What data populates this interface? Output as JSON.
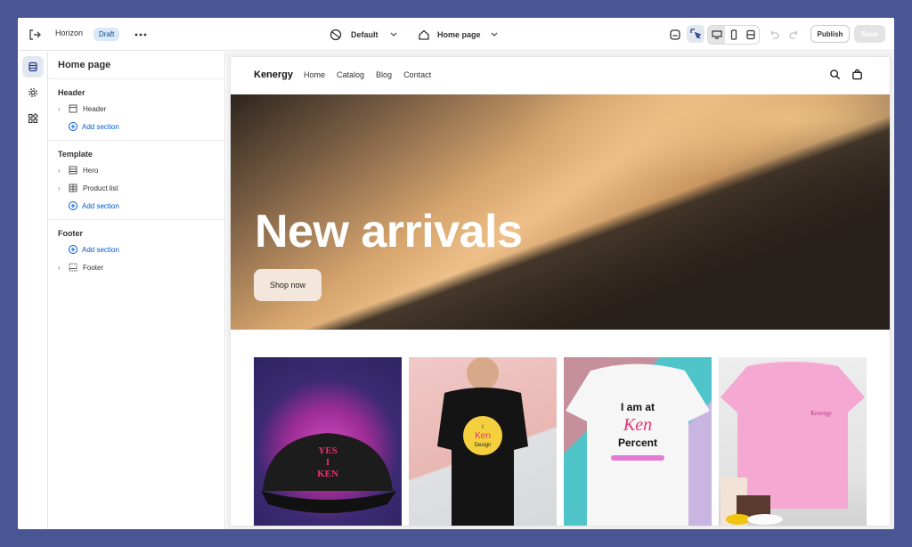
{
  "topbar": {
    "exit_icon": "exit-icon",
    "theme_name": "Horizon",
    "status_badge": "Draft",
    "template_select": "Default",
    "page_select": "Home page",
    "publish_label": "Publish",
    "save_label": "Save"
  },
  "sidebar": {
    "title": "Home page",
    "groups": [
      {
        "label": "Header",
        "items": [
          "Header"
        ],
        "add_label": "Add section"
      },
      {
        "label": "Template",
        "items": [
          "Hero",
          "Product list"
        ],
        "add_label": "Add section"
      },
      {
        "label": "Footer",
        "items": [
          "Footer"
        ],
        "add_label": "Add section"
      }
    ]
  },
  "store": {
    "brand": "Kenergy",
    "nav": [
      "Home",
      "Catalog",
      "Blog",
      "Contact"
    ],
    "hero_title": "New arrivals",
    "hero_button": "Shop now",
    "products": [
      {
        "print": [
          "YES",
          "I",
          "KEN"
        ]
      },
      {
        "print": [
          "I",
          "Ken",
          "Design"
        ]
      },
      {
        "print": [
          "I am at",
          "Ken",
          "Percent"
        ]
      },
      {
        "print": [
          "Kenergy"
        ]
      }
    ]
  },
  "colors": {
    "frame": "#4a5694",
    "accent": "#005bd3",
    "badge_bg": "#d8e8f8"
  }
}
